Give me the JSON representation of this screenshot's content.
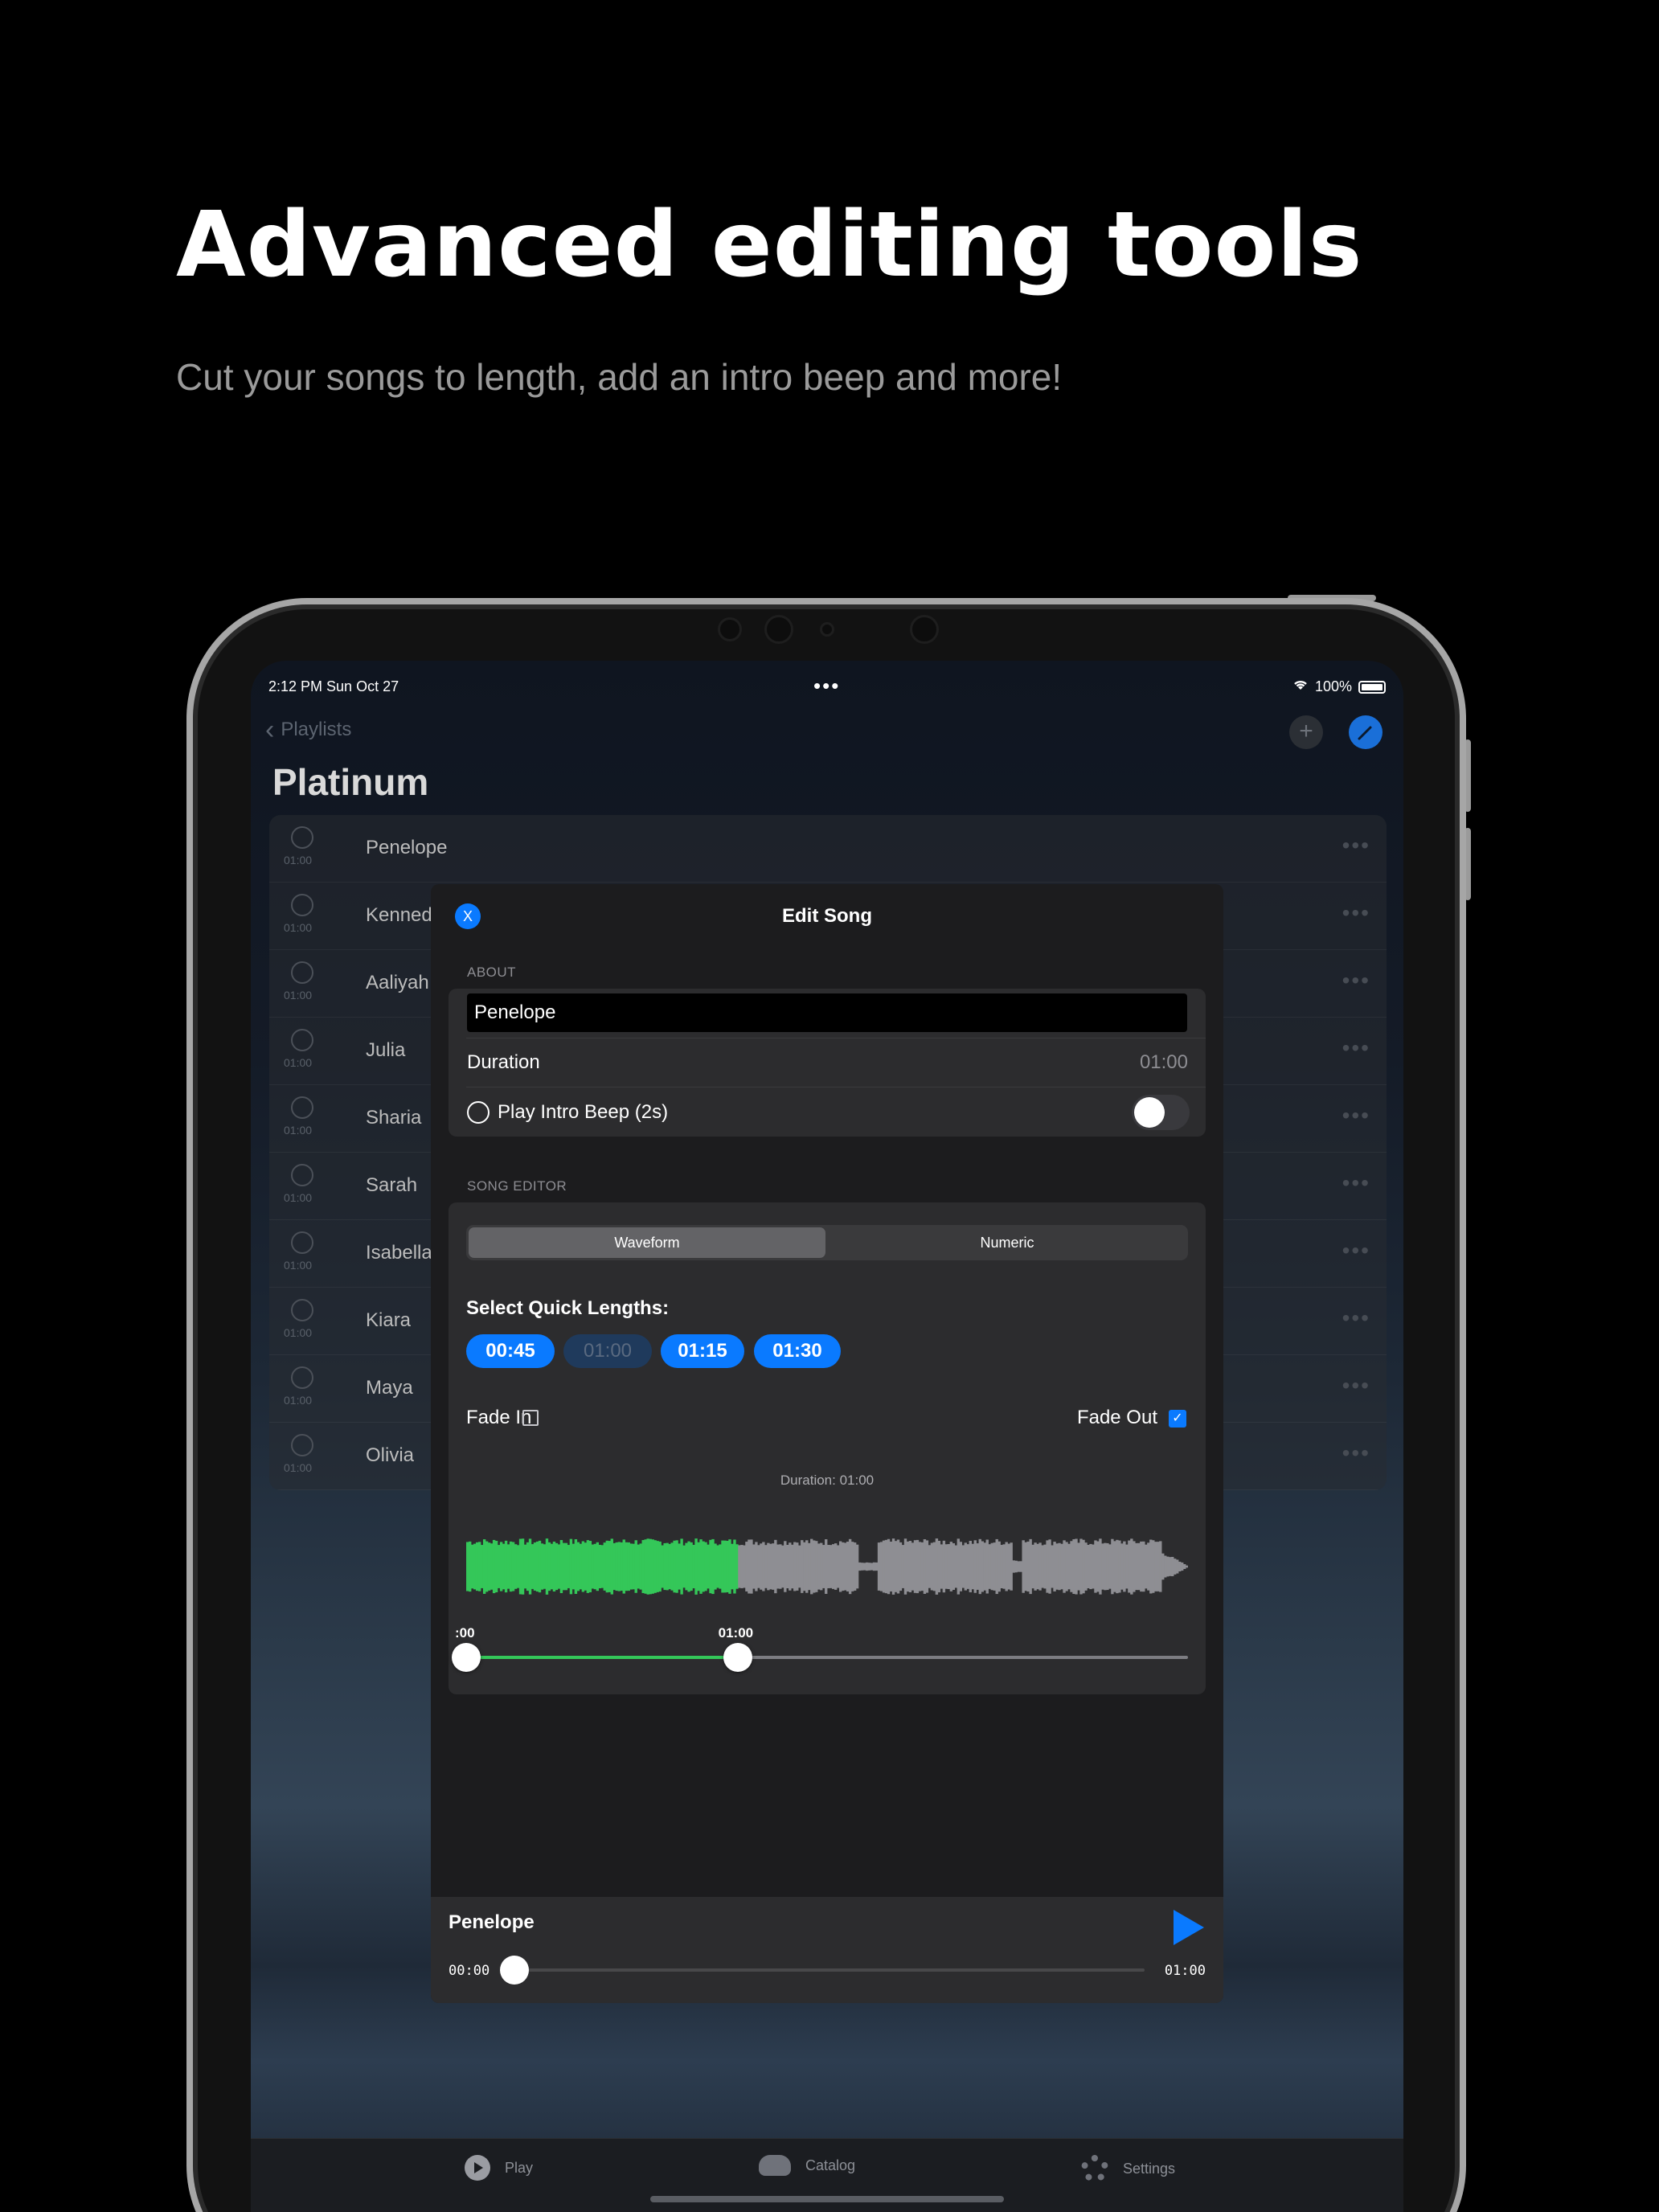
{
  "promo": {
    "headline": "Advanced editing tools",
    "subline": "Cut your songs to length, add an intro beep and more!"
  },
  "status_bar": {
    "time": "2:12 PM   Sun Oct 27",
    "dots": "•••",
    "battery": "100%"
  },
  "nav": {
    "back_label": "Playlists",
    "add_icon": "plus-icon",
    "edit_icon": "pencil-icon"
  },
  "playlist": {
    "title": "Platinum",
    "songs": [
      {
        "name": "Penelope",
        "time": "01:00"
      },
      {
        "name": "Kennedy",
        "time": "01:00"
      },
      {
        "name": "Aaliyah",
        "time": "01:00"
      },
      {
        "name": "Julia",
        "time": "01:00"
      },
      {
        "name": "Sharia",
        "time": "01:00"
      },
      {
        "name": "Sarah",
        "time": "01:00"
      },
      {
        "name": "Isabella",
        "time": "01:00"
      },
      {
        "name": "Kiara",
        "time": "01:00"
      },
      {
        "name": "Maya",
        "time": "01:00"
      },
      {
        "name": "Olivia",
        "time": "01:00"
      }
    ],
    "more_glyph": "•••"
  },
  "edit_song": {
    "close_label": "X",
    "title": "Edit Song",
    "about_label": "ABOUT",
    "name_value": "Penelope",
    "duration_label": "Duration",
    "duration_value": "01:00",
    "intro_beep_label": "Play Intro Beep (2s)",
    "intro_beep_on": false,
    "editor_label": "SONG EDITOR",
    "tabs": {
      "waveform": "Waveform",
      "numeric": "Numeric",
      "selected": "Waveform"
    },
    "quick_lengths_label": "Select Quick Lengths:",
    "quick_lengths": [
      {
        "label": "00:45",
        "enabled": true
      },
      {
        "label": "01:00",
        "enabled": false
      },
      {
        "label": "01:15",
        "enabled": true
      },
      {
        "label": "01:30",
        "enabled": true
      }
    ],
    "fade_in_label": "Fade In",
    "fade_in_checked": false,
    "fade_out_label": "Fade Out",
    "fade_out_checked": true,
    "waveform_duration": "Duration: 01:00",
    "range_start_label": ":00",
    "range_end_label": "01:00",
    "selected_fraction": 0.376,
    "colors": {
      "selected": "#34c759",
      "unselected": "#8e8e93",
      "accent": "#0a7aff"
    }
  },
  "player": {
    "title": "Penelope",
    "elapsed": "00:00",
    "total": "01:00",
    "progress": 0
  },
  "tabbar": [
    {
      "label": "Play",
      "icon": "play-circle-icon"
    },
    {
      "label": "Catalog",
      "icon": "cloud-icon"
    },
    {
      "label": "Settings",
      "icon": "gear-icon"
    }
  ]
}
